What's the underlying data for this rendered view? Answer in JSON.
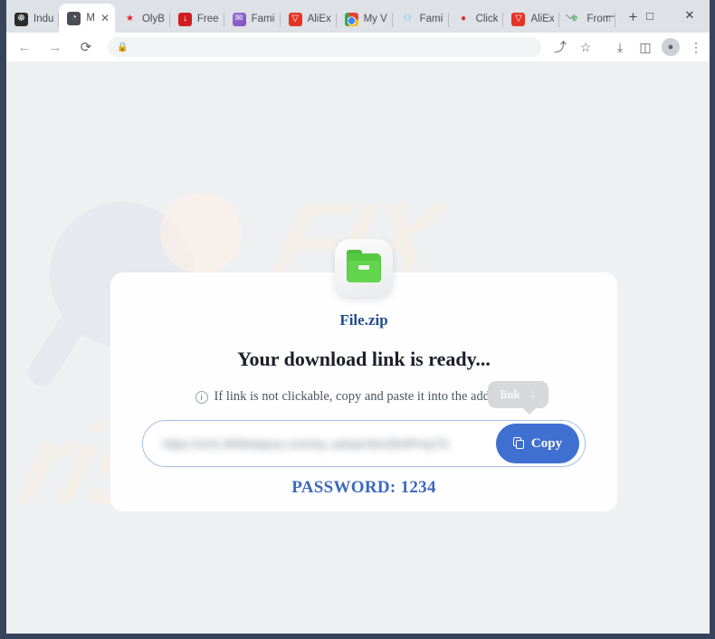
{
  "browser": {
    "tabs": [
      {
        "label": "Indu",
        "icon": "film-reel-icon",
        "icon_class": "fi-film",
        "glyph": "☸",
        "active": false
      },
      {
        "label": "M",
        "icon": "globe-icon",
        "icon_class": "fi-globe",
        "glyph": "◔",
        "active": true
      },
      {
        "label": "OlyB",
        "icon": "star-icon",
        "icon_class": "fi-star",
        "glyph": "★",
        "active": false
      },
      {
        "label": "Free",
        "icon": "red-square-icon",
        "icon_class": "fi-red",
        "glyph": "↓",
        "active": false
      },
      {
        "label": "Famil",
        "icon": "purple-circle-icon",
        "icon_class": "fi-purple",
        "glyph": "✉",
        "active": false
      },
      {
        "label": "AliEx",
        "icon": "aliexpress-icon",
        "icon_class": "fi-ali",
        "glyph": "▽",
        "active": false
      },
      {
        "label": "My V",
        "icon": "chrome-icon",
        "icon_class": "fi-chrome",
        "glyph": "",
        "active": false
      },
      {
        "label": "Famil",
        "icon": "gamepad-icon",
        "icon_class": "fi-pad",
        "glyph": "⚇",
        "active": false
      },
      {
        "label": "Click",
        "icon": "red-circle-icon",
        "icon_class": "fi-click",
        "glyph": "●",
        "active": false
      },
      {
        "label": "AliEx",
        "icon": "aliexpress-icon",
        "icon_class": "fi-ali",
        "glyph": "▽",
        "active": false
      },
      {
        "label": "From",
        "icon": "green-e-icon",
        "icon_class": "fi-green",
        "glyph": "e",
        "active": false
      }
    ],
    "tab_close_glyph": "✕",
    "new_tab_label": "+",
    "window_controls": [
      {
        "name": "tab-search-button",
        "glyph": "⌵"
      },
      {
        "name": "minimize-button",
        "glyph": "─"
      },
      {
        "name": "maximize-button",
        "glyph": "□"
      },
      {
        "name": "close-button",
        "glyph": "✕"
      }
    ],
    "toolbar": {
      "back_glyph": "←",
      "forward_glyph": "→",
      "reload_glyph": "⟳",
      "lock_glyph": "🔒",
      "url": "",
      "url_placeholder": "",
      "share_glyph": "⤴",
      "bookmark_glyph": "☆",
      "download_glyph": "⤓",
      "sidepanel_glyph": "◫",
      "profile_glyph": "●",
      "menu_glyph": "⋮"
    }
  },
  "page": {
    "watermark_top": "FIX",
    "watermark_bottom": "risk.com",
    "card": {
      "file_icon_name": "zip-folder-icon",
      "filename": "File.zip",
      "headline": "Your download link is ready...",
      "info_glyph": "i",
      "subline": "If link is not clickable, copy and paste it into the address bar.",
      "link_chip": {
        "label": "link",
        "arrow_glyph": "↓"
      },
      "link_input_value": "https://s1t1.85/8sdqsso.com/sq.-adsad.8sn28r4Pmp7S",
      "copy_button_label": "Copy",
      "password": "PASSWORD: 1234"
    }
  },
  "colors": {
    "accent_blue": "#3f6fd0",
    "link_blue": "#1f4d8f",
    "password_blue": "#3c68bf",
    "folder_green": "#63d44d",
    "page_bg": "#eef0f2",
    "card_bg": "#ffffff",
    "tooltip_gray": "#d6d8da"
  }
}
